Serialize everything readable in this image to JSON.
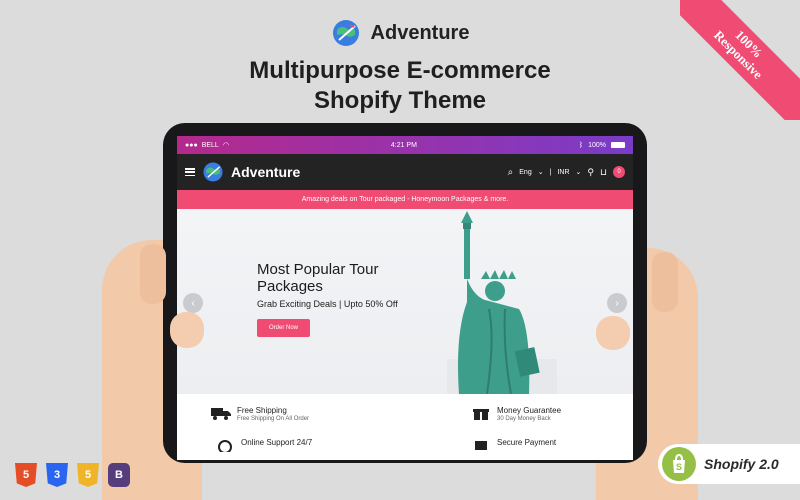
{
  "brand": {
    "name": "Adventure"
  },
  "headline": {
    "line1": "Multipurpose E-commerce",
    "line2": "Shopify Theme"
  },
  "ribbon": {
    "line1": "100%",
    "line2": "Responsive"
  },
  "status_bar": {
    "carrier": "BELL",
    "time": "4:21 PM",
    "battery": "100%"
  },
  "navbar": {
    "brand": "Adventure",
    "language": "Eng",
    "currency": "INR",
    "cart_count": "0"
  },
  "promo": {
    "text": "Amazing deals on Tour packaged - Honeymoon Packages & more."
  },
  "hero": {
    "title": "Most Popular Tour Packages",
    "subtitle": "Grab Exciting Deals | Upto 50% Off",
    "button": "Order Now"
  },
  "features": [
    {
      "title": "Free Shipping",
      "subtitle": "Free Shipping On All Order",
      "icon": "truck-icon"
    },
    {
      "title": "Money Guarantee",
      "subtitle": "30 Day Money Back",
      "icon": "gift-icon"
    },
    {
      "title": "Online Support 24/7",
      "subtitle": "",
      "icon": "headset-icon"
    },
    {
      "title": "Secure Payment",
      "subtitle": "",
      "icon": "card-icon"
    }
  ],
  "tech_badges": [
    {
      "label": "5",
      "name": "html5-icon",
      "color": "#e44d26"
    },
    {
      "label": "3",
      "name": "css3-icon",
      "color": "#2965f1"
    },
    {
      "label": "5",
      "name": "javascript-icon",
      "color": "#f0b429"
    },
    {
      "label": "B",
      "name": "bootstrap-icon",
      "color": "#563d7c"
    }
  ],
  "shopify_badge": {
    "label": "Shopify 2.0"
  },
  "colors": {
    "accent": "#ef4b73",
    "navbar": "#232323",
    "statue": "#3e9e8c"
  }
}
